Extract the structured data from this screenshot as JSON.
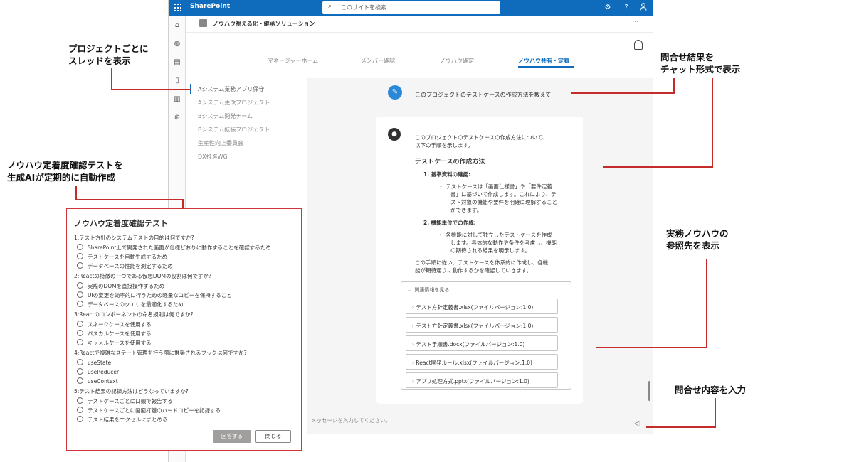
{
  "topbar": {
    "brand": "SharePoint",
    "search_placeholder": "このサイトを検索"
  },
  "site": {
    "title": "ノウハウ視える化・継承ソリューション",
    "more": "···"
  },
  "tabs": [
    {
      "label": "マネージャーホーム"
    },
    {
      "label": "メンバー確認"
    },
    {
      "label": "ノウハウ確定"
    },
    {
      "label": "ノウハウ共有・定着"
    }
  ],
  "threads": [
    {
      "label": "Aシステム業務アプリ保守"
    },
    {
      "label": "Aシステム更改プロジェクト"
    },
    {
      "label": "Bシステム開発チーム"
    },
    {
      "label": "Bシステム拡張プロジェクト"
    },
    {
      "label": "生産性向上委員会"
    },
    {
      "label": "DX推進WG"
    }
  ],
  "chat": {
    "question": "このプロジェクトのテストケースの作成方法を教えて",
    "answer_intro_1": "このプロジェクトのテストケースの作成方法について、",
    "answer_intro_2": "以下の手順を示します。",
    "answer_heading": "テストケースの作成方法",
    "step1_title": "1. 基準資料の確認:",
    "step1_lines": [
      "テストケースは「画面仕様書」や「要件定義",
      "書」に基づいて作成します。これにより、テ",
      "スト対象の機能や要件を明確に理解すること",
      "ができます。"
    ],
    "step2_title": "2. 機能単位での作成:",
    "step2_lines": [
      "各機能に対して独立したテストケースを作成",
      "します。具体的な動作や条件を考慮し、機能",
      "の期待される結果を明示します。"
    ],
    "conclusion_1": "この手順に従い、テストケースを体系的に作成し、各機",
    "conclusion_2": "能が期待通りに動作するかを確認していきます。",
    "refs_title": "関連情報を見る",
    "refs": [
      {
        "label": "テスト方針定義書.xlsx(ファイルバージョン:1.0)"
      },
      {
        "label": "テスト方針定義書.xlsx(ファイルバージョン:1.0)"
      },
      {
        "label": "テスト手順書.docx(ファイルバージョン:1.0)"
      },
      {
        "label": "React開発ルール.xlsx(ファイルバージョン:1.0)"
      },
      {
        "label": "アプリ処理方式.pptx(ファイルバージョン:1.0)"
      }
    ],
    "input_placeholder": "メッセージを入力してください。"
  },
  "quiz": {
    "title": "ノウハウ定着度確認テスト",
    "questions": [
      {
        "q": "1:テスト方針のシステムテストの目的は何ですか?",
        "options": [
          "SharePoint上で開発された画面が仕様どおりに動作することを確認するため",
          "テストケースを自動生成するため",
          "データベースの性能を測定するため"
        ]
      },
      {
        "q": "2:Reactの特徴の一つである仮想DOMの役割は何ですか?",
        "options": [
          "実際のDOMを直接操作するため",
          "UIの変更を効率的に行うための軽量なコピーを保持すること",
          "データベースのクエリを最適化するため"
        ]
      },
      {
        "q": "3:Reactのコンポーネントの命名規則は何ですか?",
        "options": [
          "スネークケースを使用する",
          "パスカルケースを使用する",
          "キャメルケースを使用する"
        ]
      },
      {
        "q": "4:Reactで複雑なステート管理を行う際に推奨されるフックは何ですか?",
        "options": [
          "useState",
          "useReducer",
          "useContext"
        ]
      },
      {
        "q": "5:テスト結果の記録方法はどうなっていますか?",
        "options": [
          "テストケースごとに口頭で報告する",
          "テストケースごとに画面打鍵のハードコピーを記録する",
          "テスト結果をエクセルにまとめる"
        ]
      }
    ],
    "submit_label": "回答する",
    "close_label": "閉じる"
  },
  "annotations": {
    "threads_1": "プロジェクトごとに",
    "threads_2": "スレッドを表示",
    "chat_1": "問合せ結果を",
    "chat_2": "チャット形式で表示",
    "quiz_1": "ノウハウ定着度確認テストを",
    "quiz_2": "生成AIが定期的に自動作成",
    "refs_1": "実務ノウハウの",
    "refs_2": "参照先を表示",
    "input": "問合せ内容を入力"
  },
  "colors": {
    "brand": "#0f6cbd",
    "annotation_line": "#c42b2b"
  }
}
